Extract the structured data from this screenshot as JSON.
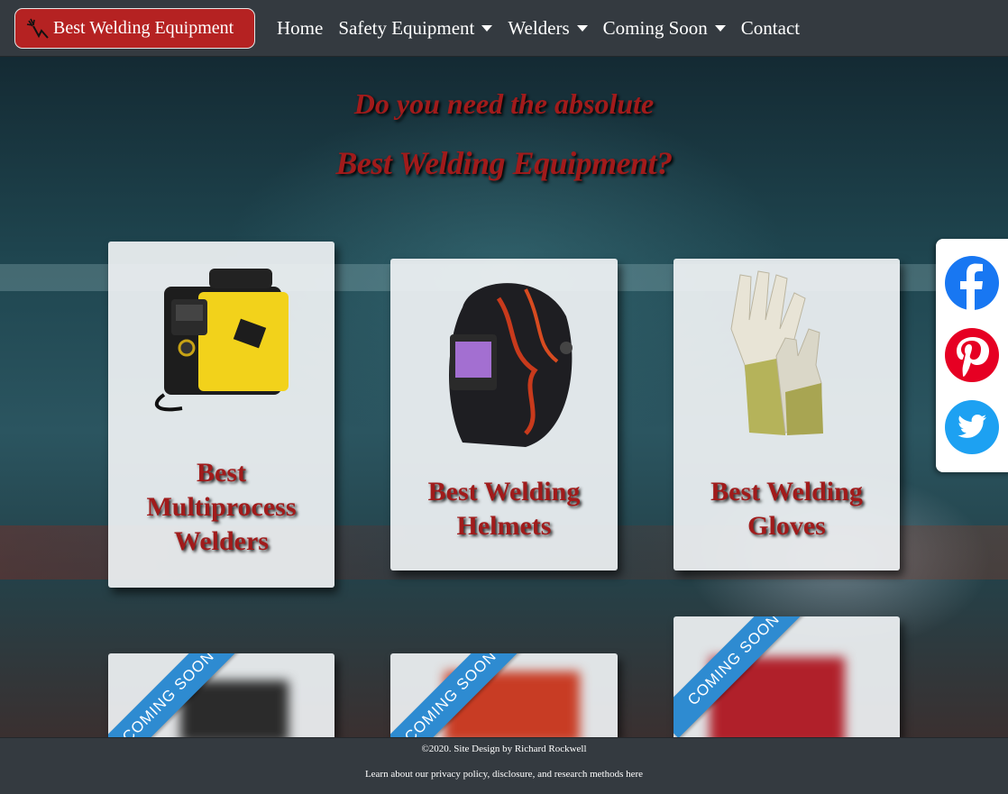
{
  "brand": {
    "label": "Best Welding Equipment"
  },
  "nav": {
    "home": "Home",
    "safety": "Safety Equipment",
    "welders": "Welders",
    "coming_soon": "Coming Soon",
    "contact": "Contact"
  },
  "hero": {
    "line1": "Do you need the absolute",
    "line2": "Best Welding Equipment?"
  },
  "cards": [
    {
      "title_lines": [
        "Best",
        "Multiprocess",
        "Welders"
      ],
      "image": "multiprocess-welder-image"
    },
    {
      "title_lines": [
        "Best Welding",
        "Helmets"
      ],
      "image": "welding-helmet-image"
    },
    {
      "title_lines": [
        "Best Welding",
        "Gloves"
      ],
      "image": "welding-gloves-image"
    }
  ],
  "coming_soon_cards": [
    {
      "ribbon": "COMING SOON"
    },
    {
      "ribbon": "COMING SOON"
    },
    {
      "ribbon": "COMING SOON"
    }
  ],
  "social": [
    "facebook-icon",
    "pinterest-icon",
    "twitter-icon"
  ],
  "colors": {
    "navbar": "#343a40",
    "brand_red": "#b52222",
    "title_red": "#a11b1b",
    "ribbon_blue": "#2e8bd1",
    "facebook": "#1877f2",
    "pinterest": "#e60023",
    "twitter": "#1da1f2"
  },
  "footer": {
    "copyright": "©2020. Site Design by Richard Rockwell",
    "learn": "Learn about our privacy policy, disclosure, and research methods here"
  }
}
